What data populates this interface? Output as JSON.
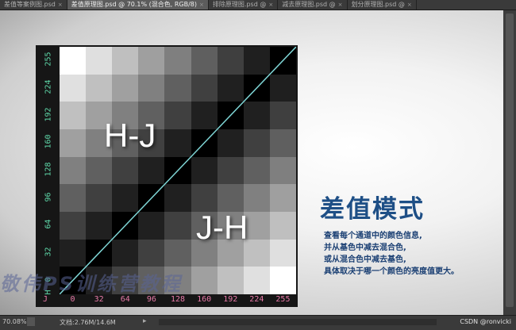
{
  "tabs": [
    {
      "label": "差值等案例图.psd",
      "active": false
    },
    {
      "label": "差值原理图.psd @ 70.1% (混合色, RGB/8)",
      "active": true
    },
    {
      "label": "排除原理图.psd @",
      "active": false
    },
    {
      "label": "减去原理图.psd @",
      "active": false
    },
    {
      "label": "划分原理图.psd @",
      "active": false
    }
  ],
  "slide": {
    "y_axis_label": "H",
    "x_axis_label": "J",
    "y_ticks": [
      "255",
      "224",
      "192",
      "160",
      "128",
      "96",
      "64",
      "32",
      "0"
    ],
    "x_ticks": [
      "0",
      "32",
      "64",
      "96",
      "128",
      "160",
      "192",
      "224",
      "255"
    ],
    "upper_label": "H-J",
    "lower_label": "J-H",
    "title": "差值模式",
    "desc_lines": [
      "查看每个通道中的颜色信息,",
      "并从基色中减去混合色,",
      "或从混合色中减去基色,",
      "具体取决于哪一个颜色的亮度值更大。"
    ],
    "watermark": "敬伟PS训练营教程"
  },
  "colors": {
    "y_axis": "#5ed7a8",
    "x_axis": "#e87aa8",
    "title": "#1e4f86",
    "diagonal": "#7fd6d6"
  },
  "status": {
    "zoom": "70.08%",
    "doc": "文档:2.76M/14.6M",
    "credit": "CSDN @ronvicki"
  }
}
